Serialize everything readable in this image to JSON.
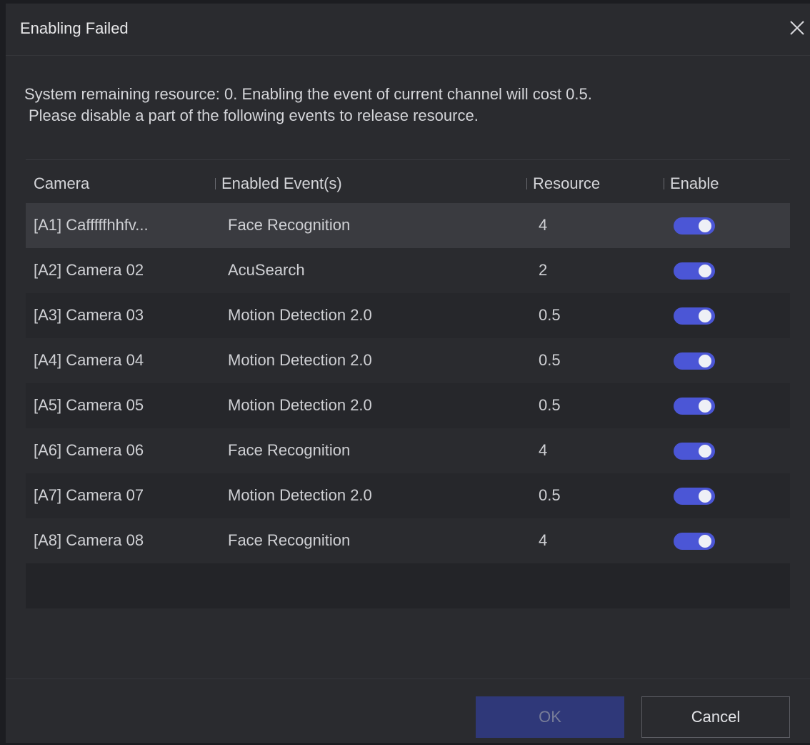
{
  "dialog": {
    "title": "Enabling Failed",
    "message_line1": "System remaining resource: 0. Enabling the event of current channel will cost 0.5.",
    "message_line2": "Please disable a part of the following events to release resource."
  },
  "table": {
    "columns": [
      "Camera",
      "Enabled Event(s)",
      "Resource",
      "Enable"
    ],
    "rows": [
      {
        "camera": "[A1] Cafffffhhfv...",
        "event": "Face Recognition",
        "resource": "4",
        "enabled": true
      },
      {
        "camera": "[A2] Camera 02",
        "event": "AcuSearch",
        "resource": "2",
        "enabled": true
      },
      {
        "camera": "[A3] Camera 03",
        "event": "Motion Detection 2.0",
        "resource": "0.5",
        "enabled": true
      },
      {
        "camera": "[A4] Camera 04",
        "event": "Motion Detection 2.0",
        "resource": "0.5",
        "enabled": true
      },
      {
        "camera": "[A5] Camera 05",
        "event": "Motion Detection 2.0",
        "resource": "0.5",
        "enabled": true
      },
      {
        "camera": "[A6] Camera 06",
        "event": "Face Recognition",
        "resource": "4",
        "enabled": true
      },
      {
        "camera": "[A7] Camera 07",
        "event": "Motion Detection 2.0",
        "resource": "0.5",
        "enabled": true
      },
      {
        "camera": "[A8] Camera 08",
        "event": "Face Recognition",
        "resource": "4",
        "enabled": true
      }
    ]
  },
  "footer": {
    "ok_label": "OK",
    "cancel_label": "Cancel"
  },
  "colors": {
    "accent": "#4b56d6",
    "ok_button_disabled": "#2f3879",
    "background": "#2a2b2f"
  },
  "icons": {
    "close": "close-icon"
  }
}
